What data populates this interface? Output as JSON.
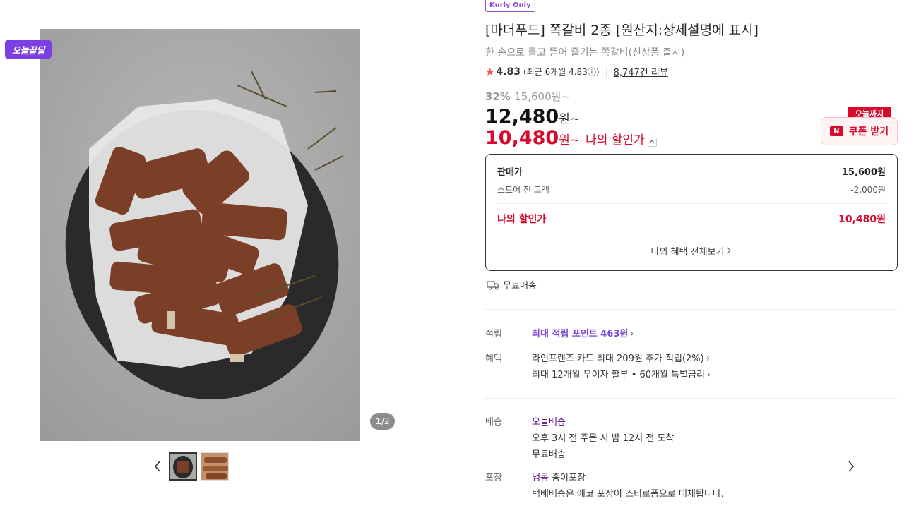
{
  "gallery": {
    "deal_badge": "오늘끝딜",
    "page_current": "1",
    "page_total": "/2"
  },
  "product": {
    "kurly_badge": "Kurly Only",
    "title": "[마더푸드] 쪽갈비 2종 [원산지:상세설명에 표시]",
    "subtitle": "한 손으로 들고 뜯어 즐기는 쪽갈비(신상품 출시)",
    "rating": "4.83",
    "rating_recent": "(최근 6개월 4.83ⓘ)",
    "reviews": "8,747건 리뷰",
    "discount_rate": "32%",
    "original_price": "15,600원~",
    "price": "12,480",
    "price_unit": "원~",
    "my_price": "10,480",
    "my_price_unit": "원~",
    "my_price_label": "나의 할인가",
    "today_tag": "오늘까지",
    "coupon_label": "쿠폰 받기"
  },
  "price_box": {
    "sale_label": "판매가",
    "sale_value": "15,600원",
    "store_label": "스토어 전 고객",
    "store_value": "-2,000원",
    "mine_label": "나의 할인가",
    "mine_value": "10,480원",
    "benefits_link": "나의 혜택 전체보기"
  },
  "shipping_note": "무료배송",
  "details": {
    "points_label": "적립",
    "points_value": "최대 적립 포인트 463원",
    "benefit_label": "혜택",
    "benefit_1": "라인프렌즈 카드 최대 209원 추가 적립(2%)",
    "benefit_2": "최대 12개월 무이자 할부 • 60개월 특별금리",
    "delivery_label": "배송",
    "delivery_type": "오늘배송",
    "delivery_time": "오후 3시 전 주문 시 밤 12시 전 도착",
    "delivery_fee": "무료배송",
    "packing_label": "포장",
    "packing_frozen": "냉동",
    "packing_type": "종이포장",
    "packing_note": "택배배송은 에코 포장이 스티로폼으로 대체됩니다."
  },
  "colors": {
    "accent_red": "#d7092c",
    "kurly_purple": "#5f0080",
    "deal_purple": "#7b3fe4"
  }
}
